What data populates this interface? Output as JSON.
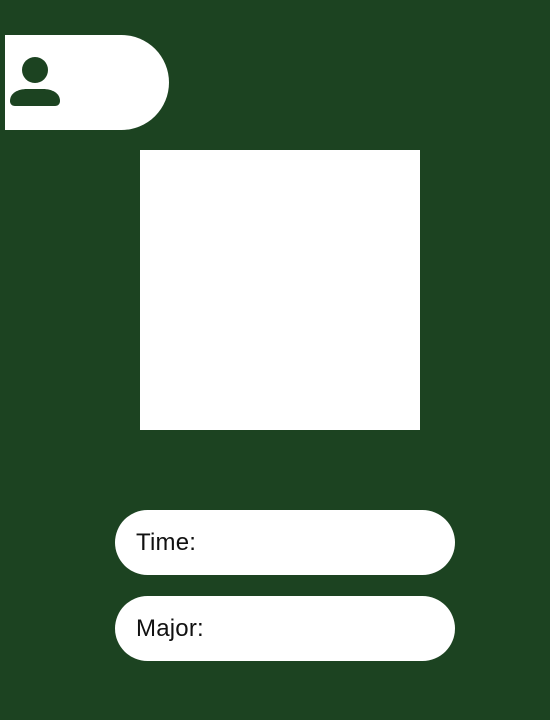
{
  "profile": {
    "icon": "user-icon"
  },
  "fields": {
    "time_label": "Time:",
    "major_label": "Major:"
  },
  "colors": {
    "background": "#1c4321",
    "surface": "#ffffff",
    "text": "#111111"
  }
}
